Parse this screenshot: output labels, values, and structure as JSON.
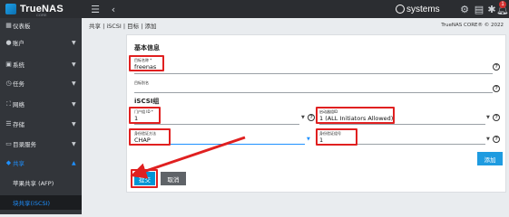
{
  "app": {
    "brand": "TrueNAS",
    "brand_sub": "CORE",
    "ix_logo": "systems",
    "notification_count": "1"
  },
  "topbar_icons": [
    "menu-icon",
    "back-chevron-icon",
    "ix-systems-logo",
    "system-settings-icon",
    "clipboard-icon",
    "gear-icon",
    "bell-icon"
  ],
  "sidebar": {
    "items": [
      {
        "label": "仪表板",
        "icon": "dashboard-icon"
      },
      {
        "label": "账户",
        "icon": "account-icon",
        "arrow": "▼"
      },
      {
        "label": "系统",
        "icon": "system-icon",
        "arrow": "▼"
      },
      {
        "label": "任务",
        "icon": "tasks-icon",
        "arrow": "▼"
      },
      {
        "label": "网络",
        "icon": "network-icon",
        "arrow": "▼"
      },
      {
        "label": "存储",
        "icon": "storage-icon",
        "arrow": "▼"
      },
      {
        "label": "目录服务",
        "icon": "directory-icon",
        "arrow": "▼"
      },
      {
        "label": "共享",
        "icon": "share-icon",
        "arrow": "▲"
      },
      {
        "label": "苹果共享 (AFP)"
      },
      {
        "label": "块共享(iSCSI)"
      }
    ]
  },
  "breadcrumb": {
    "text": "共享 | iSCSI | 目标 | 添加",
    "copyright": "TrueNAS CORE® © 2022"
  },
  "form": {
    "basic_info_title": "基本信息",
    "target_name_label": "目标名称 *",
    "target_name_value": "freenas",
    "target_alias_label": "目标别名",
    "iscsi_group_title": "iSCSI组",
    "portal_group_label": "门户组 ID *",
    "portal_group_value": "1",
    "initiator_group_label": "启动器组ID",
    "initiator_group_value": "1 (ALL Initiators Allowed)",
    "auth_method_label": "身份验证方法",
    "auth_method_value": "CHAP",
    "auth_group_label": "身份验证组号",
    "auth_group_value": "1",
    "add_label": "添加",
    "submit_label": "提交",
    "cancel_label": "取消"
  },
  "colors": {
    "accent": "#0095d5",
    "highlight": "#e02020",
    "sidebar_bg": "#32353a",
    "topbar_bg": "#2b2d31"
  }
}
